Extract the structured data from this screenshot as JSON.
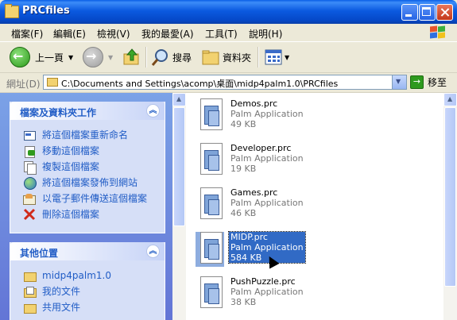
{
  "window": {
    "title": "PRCfiles"
  },
  "menu": [
    "檔案(F)",
    "編輯(E)",
    "檢視(V)",
    "我的最愛(A)",
    "工具(T)",
    "說明(H)"
  ],
  "toolbar": {
    "back_label": "上一頁",
    "search_label": "搜尋",
    "folders_label": "資料夾"
  },
  "address": {
    "label": "網址(D)",
    "path": "C:\\Documents and Settings\\acomp\\桌面\\midp4palm1.0\\PRCfiles",
    "go_label": "移至"
  },
  "tasks_panel": {
    "title": "檔案及資料夾工作",
    "items": [
      "將這個檔案重新命名",
      "移動這個檔案",
      "複製這個檔案",
      "將這個檔案發佈到網站",
      "以電子郵件傳送這個檔案",
      "刪除這個檔案"
    ]
  },
  "places_panel": {
    "title": "其他位置",
    "items": [
      "midp4palm1.0",
      "我的文件",
      "共用文件"
    ]
  },
  "files": [
    {
      "name": "Demos.prc",
      "type": "Palm Application",
      "size": "49 KB",
      "selected": false
    },
    {
      "name": "Developer.prc",
      "type": "Palm Application",
      "size": "19 KB",
      "selected": false
    },
    {
      "name": "Games.prc",
      "type": "Palm Application",
      "size": "46 KB",
      "selected": false
    },
    {
      "name": "MIDP.prc",
      "type": "Palm Application",
      "size": "584 KB",
      "selected": true
    },
    {
      "name": "PushPuzzle.prc",
      "type": "Palm Application",
      "size": "38 KB",
      "selected": false
    }
  ],
  "icons": {
    "back": "back-arrow-icon",
    "forward": "forward-arrow-icon",
    "up": "up-folder-icon",
    "search": "magnifier-icon",
    "folders": "folder-tree-icon",
    "views": "views-grid-icon"
  }
}
